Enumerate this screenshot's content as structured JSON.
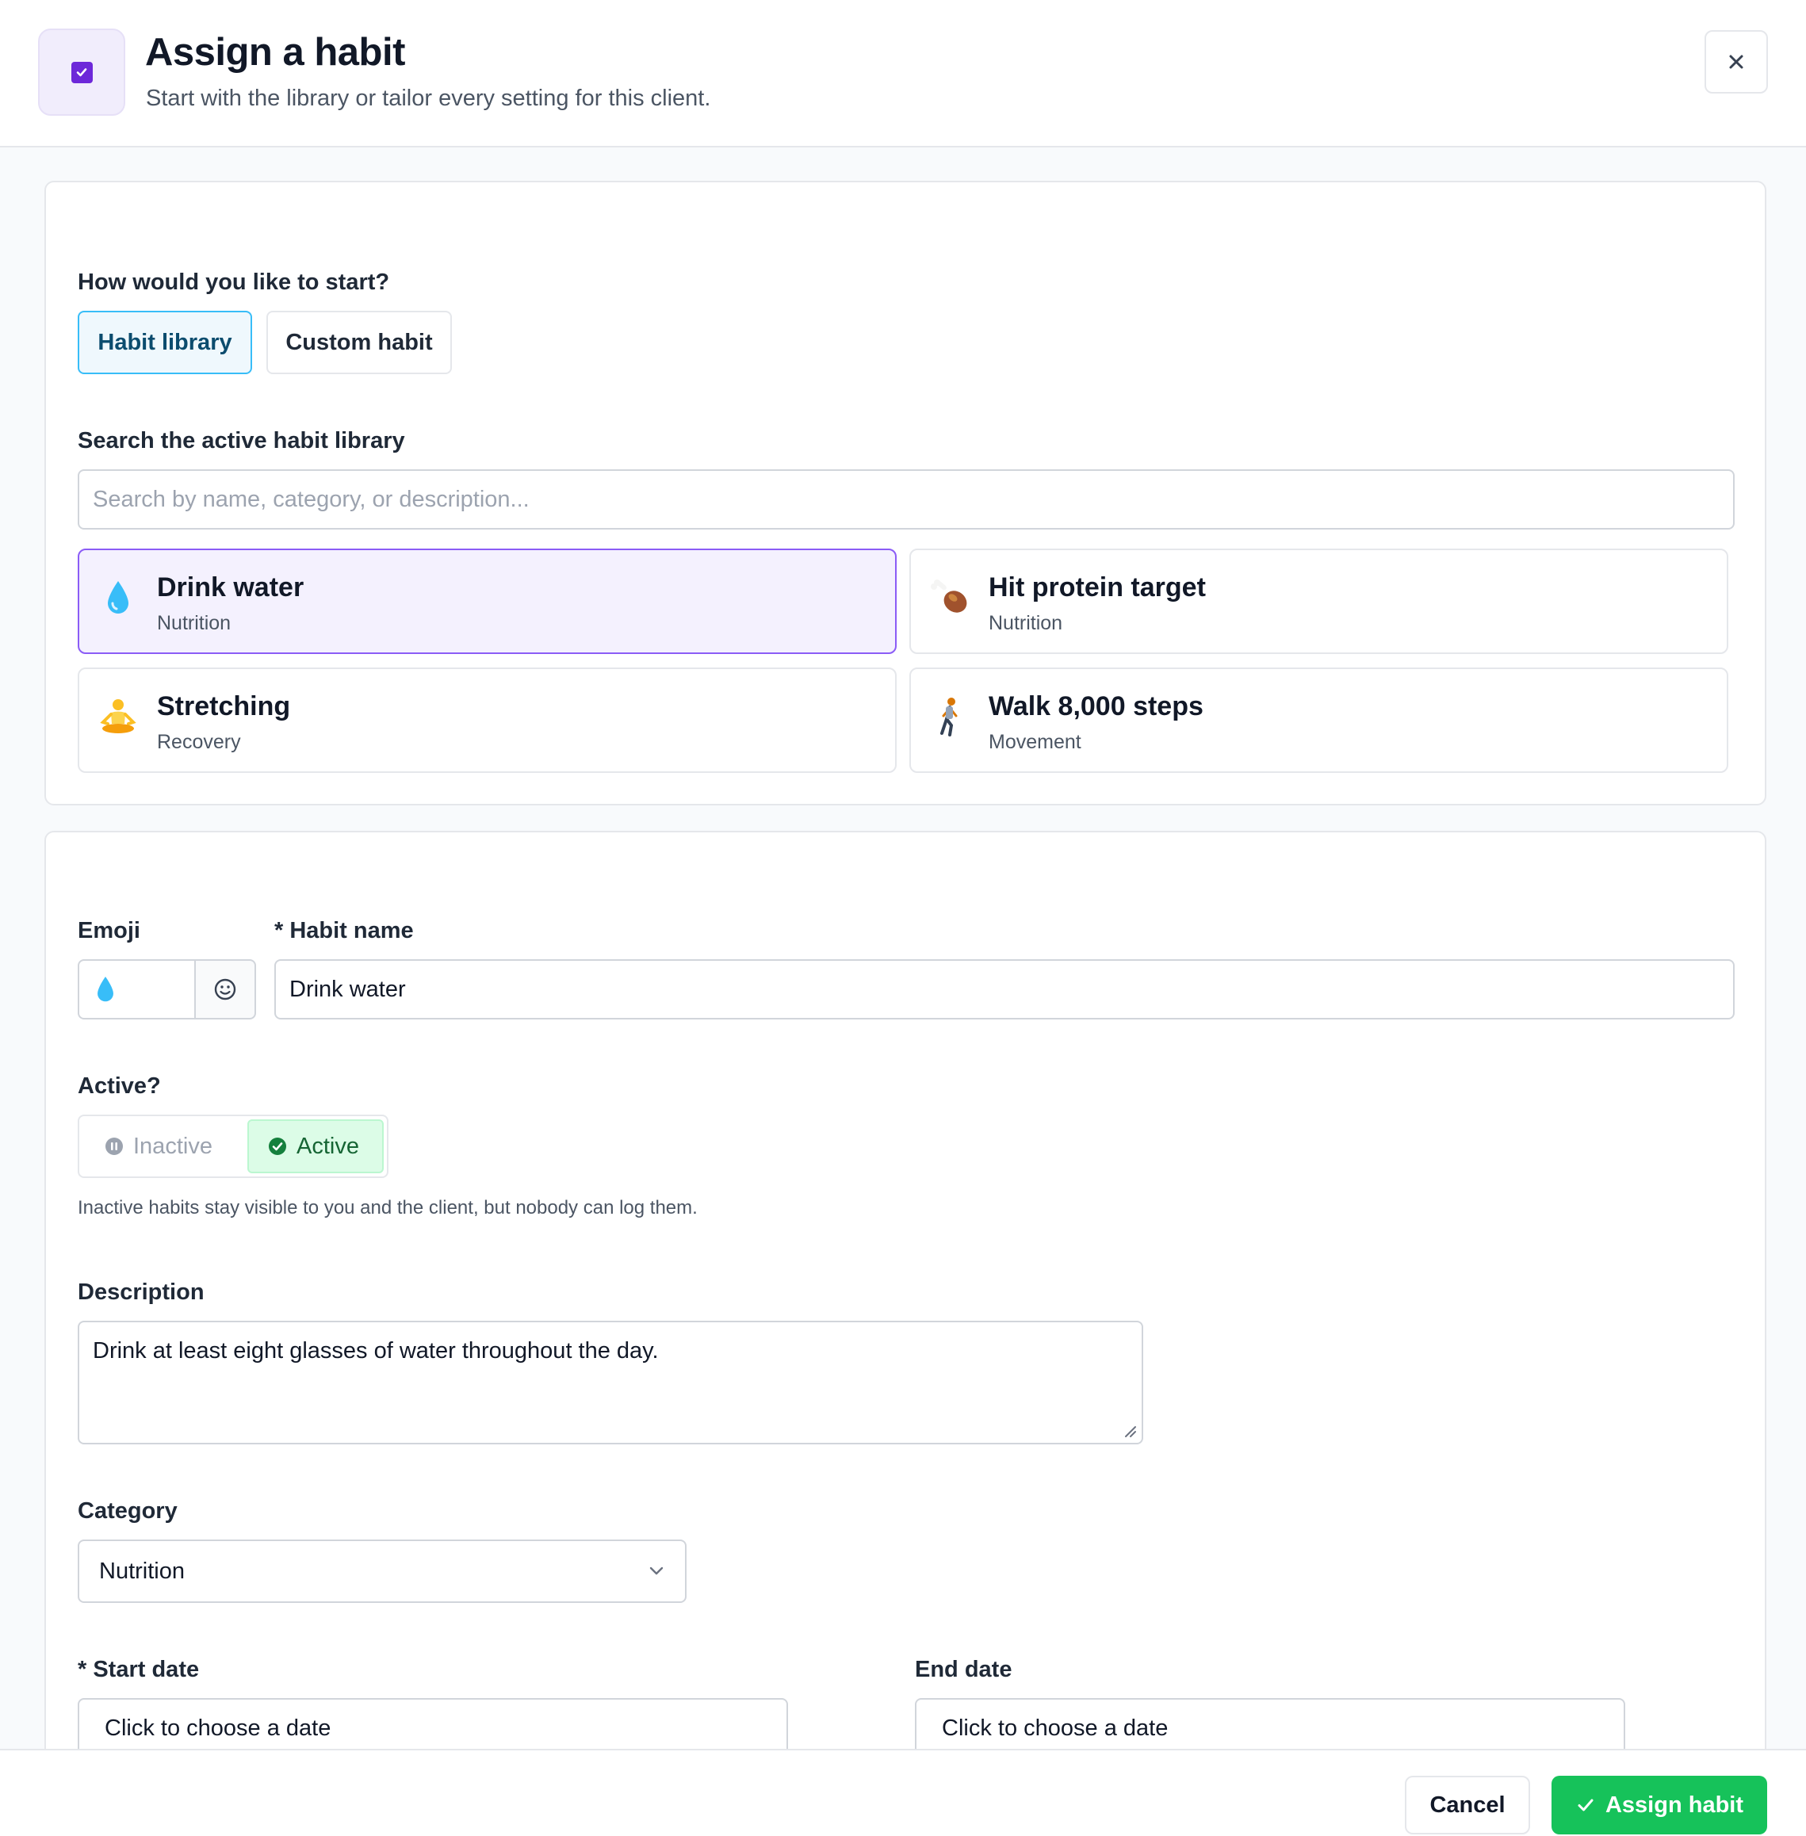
{
  "dialog": {
    "title": "Assign a habit",
    "subtitle": "Start with the library or tailor every setting for this client."
  },
  "start": {
    "question": "How would you like to start?",
    "options": [
      "Habit library",
      "Custom habit"
    ],
    "selected": "Habit library"
  },
  "search": {
    "label": "Search the active habit library",
    "placeholder": "Search by name, category, or description..."
  },
  "library": [
    {
      "emoji": "💧",
      "icon": "droplet-icon",
      "name": "Drink water",
      "category": "Nutrition",
      "selected": true
    },
    {
      "emoji": "🍗",
      "icon": "drumstick-icon",
      "name": "Hit protein target",
      "category": "Nutrition",
      "selected": false
    },
    {
      "emoji": "🧘",
      "icon": "meditation-icon",
      "name": "Stretching",
      "category": "Recovery",
      "selected": false
    },
    {
      "emoji": "🚶",
      "icon": "walking-icon",
      "name": "Walk 8,000 steps",
      "category": "Movement",
      "selected": false
    }
  ],
  "form": {
    "emoji_label": "Emoji",
    "emoji_value": "💧",
    "name_label": "* Habit name",
    "name_value": "Drink water",
    "active_label": "Active?",
    "inactive_option": "Inactive",
    "active_option": "Active",
    "active_selected": true,
    "active_hint": "Inactive habits stay visible to you and the client, but nobody can log them.",
    "description_label": "Description",
    "description_value": "Drink at least eight glasses of water throughout the day.",
    "category_label": "Category",
    "category_value": "Nutrition",
    "start_date_label": "* Start date",
    "start_date_placeholder": "Click to choose a date",
    "end_date_label": "End date",
    "end_date_placeholder": "Click to choose a date"
  },
  "footer": {
    "cancel": "Cancel",
    "assign": "Assign habit"
  },
  "colors": {
    "accent_purple": "#6d28d9",
    "selected_card_border": "#8b5cf6",
    "active_green": "#16c25a",
    "segment_selected_border": "#38bdf8"
  }
}
